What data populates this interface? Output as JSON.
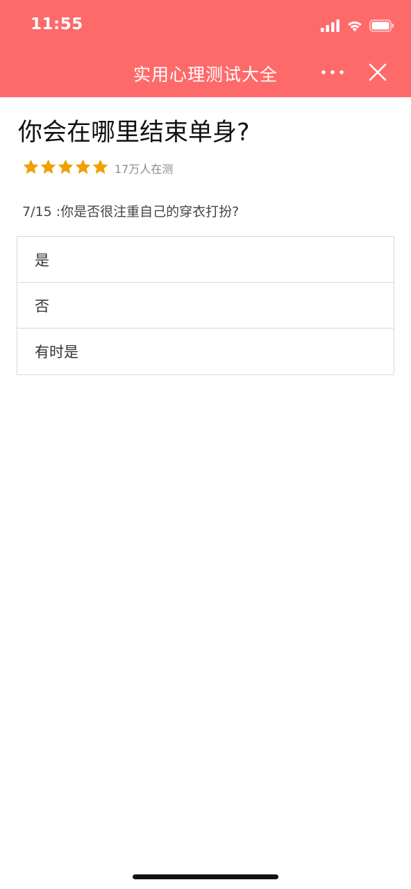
{
  "status_bar": {
    "time": "11:55"
  },
  "nav_bar": {
    "title": "实用心理测试大全",
    "more_icon": "more-dots-icon",
    "close_icon": "close-icon"
  },
  "quiz": {
    "title": "你会在哪里结束单身?",
    "rating": {
      "stars_filled": 5,
      "stars_total": 5,
      "star_color": "#f0a000",
      "participants": "17万人在测"
    },
    "question": "7/15 :你是否很注重自己的穿衣打扮?",
    "options": [
      {
        "label": "是"
      },
      {
        "label": "否"
      },
      {
        "label": "有时是"
      }
    ]
  },
  "colors": {
    "header_bg": "#fe6a6a",
    "page_bg": "#ffffff",
    "border": "#d8d8d8"
  }
}
